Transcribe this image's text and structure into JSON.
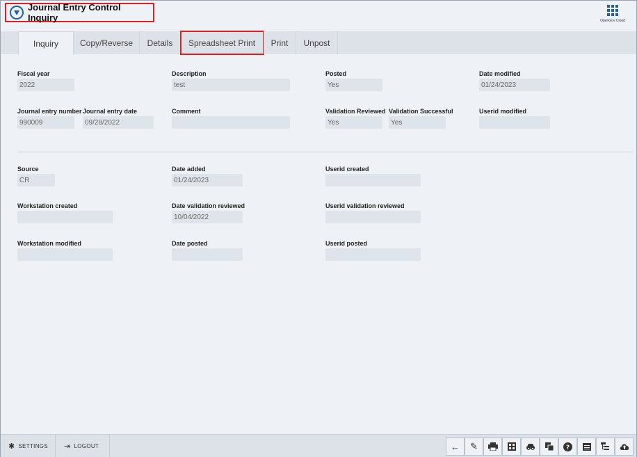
{
  "app": {
    "title": "Journal Entry Control Inquiry",
    "apps_label": "OpenGov Cloud"
  },
  "tabs": [
    {
      "label": "Inquiry",
      "active": true
    },
    {
      "label": "Copy/Reverse"
    },
    {
      "label": "Details"
    },
    {
      "label": "Spreadsheet Print",
      "highlighted": true
    },
    {
      "label": "Print"
    },
    {
      "label": "Unpost"
    }
  ],
  "fields": {
    "fiscal_year": {
      "label": "Fiscal year",
      "value": "2022"
    },
    "description": {
      "label": "Description",
      "value": "test"
    },
    "posted": {
      "label": "Posted",
      "value": "Yes"
    },
    "date_modified": {
      "label": "Date modified",
      "value": "01/24/2023"
    },
    "journal_entry_number": {
      "label": "Journal entry number",
      "value": "990009"
    },
    "journal_entry_date": {
      "label": "Journal entry date",
      "value": "09/28/2022"
    },
    "comment": {
      "label": "Comment",
      "value": ""
    },
    "validation_reviewed": {
      "label": "Validation Reviewed",
      "value": "Yes"
    },
    "validation_successful": {
      "label": "Validation Successful",
      "value": "Yes"
    },
    "userid_modified": {
      "label": "Userid modified",
      "value": ""
    },
    "source": {
      "label": "Source",
      "value": "CR"
    },
    "date_added": {
      "label": "Date added",
      "value": "01/24/2023"
    },
    "userid_created": {
      "label": "Userid created",
      "value": ""
    },
    "workstation_created": {
      "label": "Workstation created",
      "value": ""
    },
    "date_validation_reviewed": {
      "label": "Date validation reviewed",
      "value": "10/04/2022"
    },
    "userid_validation_reviewed": {
      "label": "Userid validation reviewed",
      "value": ""
    },
    "workstation_modified": {
      "label": "Workstation modified",
      "value": ""
    },
    "date_posted": {
      "label": "Date posted",
      "value": ""
    },
    "userid_posted": {
      "label": "Userid posted",
      "value": ""
    }
  },
  "footer": {
    "settings_label": "SETTINGS",
    "logout_label": "LOGOUT"
  },
  "toolbar_icons": [
    "back-arrow-icon",
    "edit-pencil-icon",
    "print-icon",
    "calculator-icon",
    "car-icon",
    "copy-pages-icon",
    "help-icon",
    "calendar-icon",
    "hierarchy-icon",
    "cloud-upload-icon"
  ],
  "colors": {
    "accent": "#1f5fa8",
    "highlight_border": "#e02020",
    "background": "#eef2f6"
  }
}
